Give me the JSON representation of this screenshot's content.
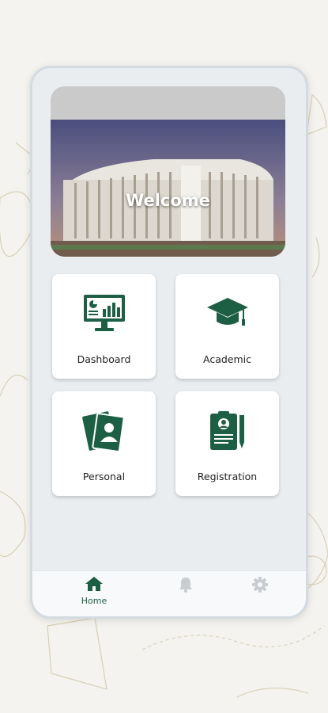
{
  "hero": {
    "title": "Welcome"
  },
  "tiles": [
    {
      "label": "Dashboard",
      "icon": "dashboard-monitor-icon"
    },
    {
      "label": "Academic",
      "icon": "graduation-cap-icon"
    },
    {
      "label": "Personal",
      "icon": "id-cards-icon"
    },
    {
      "label": "Registration",
      "icon": "registration-form-icon"
    }
  ],
  "nav": {
    "home": {
      "label": "Home",
      "icon": "home-icon"
    },
    "notifications": {
      "icon": "bell-icon"
    },
    "settings": {
      "icon": "gear-icon"
    }
  },
  "colors": {
    "accent": "#1d5f44",
    "background": "#f4f3ef",
    "panel": "#e9edf0"
  }
}
